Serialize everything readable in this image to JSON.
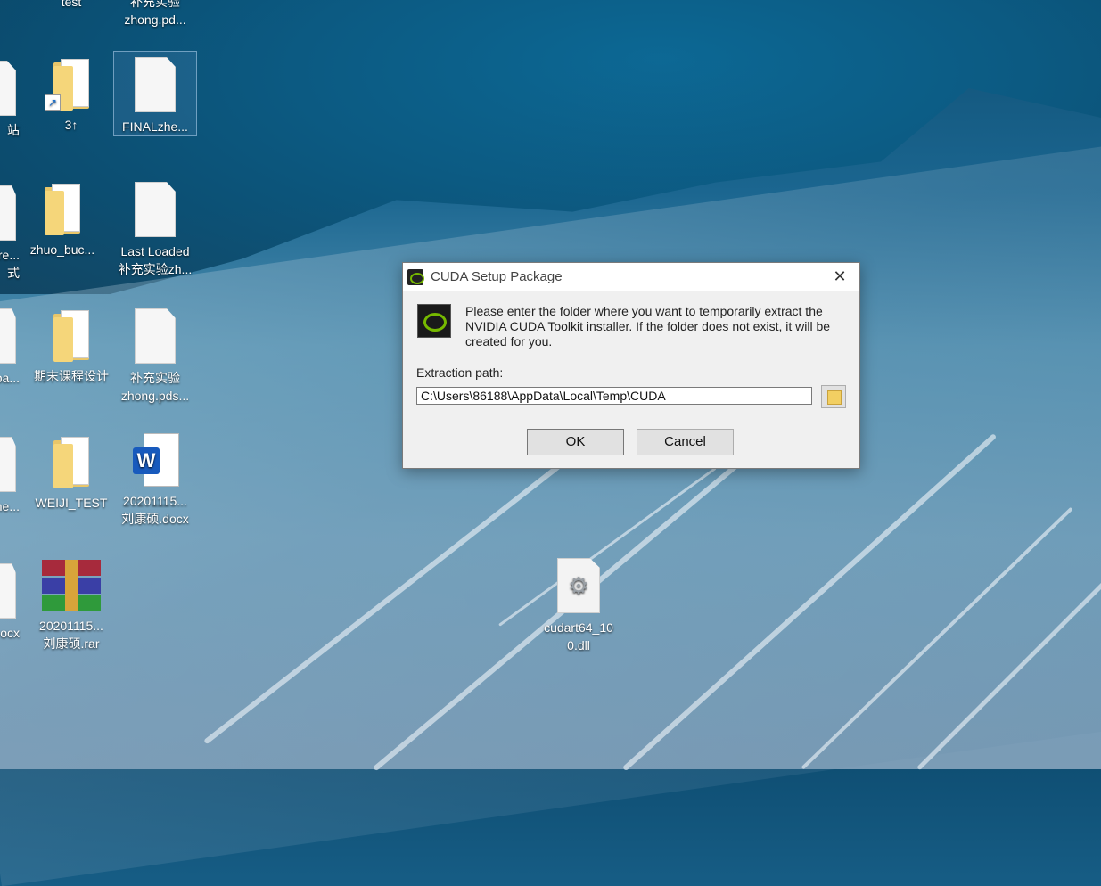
{
  "desktop": {
    "icons": [
      {
        "label": "test",
        "kind": "folder"
      },
      {
        "label": "补充实验\nzhong.pd...",
        "kind": "doc"
      },
      {
        "label": "站",
        "kind": "recycle"
      },
      {
        "label": "3↑",
        "kind": "folder-shortcut"
      },
      {
        "label": "FINALzhe...",
        "kind": "doc"
      },
      {
        "label": "re...\n式",
        "kind": "app"
      },
      {
        "label": "zhuo_buc...",
        "kind": "folder"
      },
      {
        "label": "Last Loaded\n补充实验zh...",
        "kind": "doc"
      },
      {
        "label": "ba...",
        "kind": "doc"
      },
      {
        "label": "期末课程设计",
        "kind": "folder"
      },
      {
        "label": "补充实验\nzhong.pds...",
        "kind": "doc"
      },
      {
        "label": "ne...",
        "kind": "doc"
      },
      {
        "label": "WEIJI_TEST",
        "kind": "folder"
      },
      {
        "label": "20201115...\n刘康硕.docx",
        "kind": "word"
      },
      {
        "label": "ocx",
        "kind": "doc"
      },
      {
        "label": "20201115...\n刘康硕.rar",
        "kind": "rar"
      },
      {
        "label": "cudart64_10\n0.dll",
        "kind": "dll"
      }
    ]
  },
  "dialog": {
    "title": "CUDA Setup Package",
    "close_glyph": "✕",
    "message": "Please enter the folder where you want to temporarily extract the NVIDIA CUDA Toolkit installer. If the folder does not exist, it will be created for you.",
    "path_label": "Extraction path:",
    "path_value": "C:\\Users\\86188\\AppData\\Local\\Temp\\CUDA",
    "ok_label": "OK",
    "cancel_label": "Cancel",
    "brand_color": "#76b900"
  }
}
